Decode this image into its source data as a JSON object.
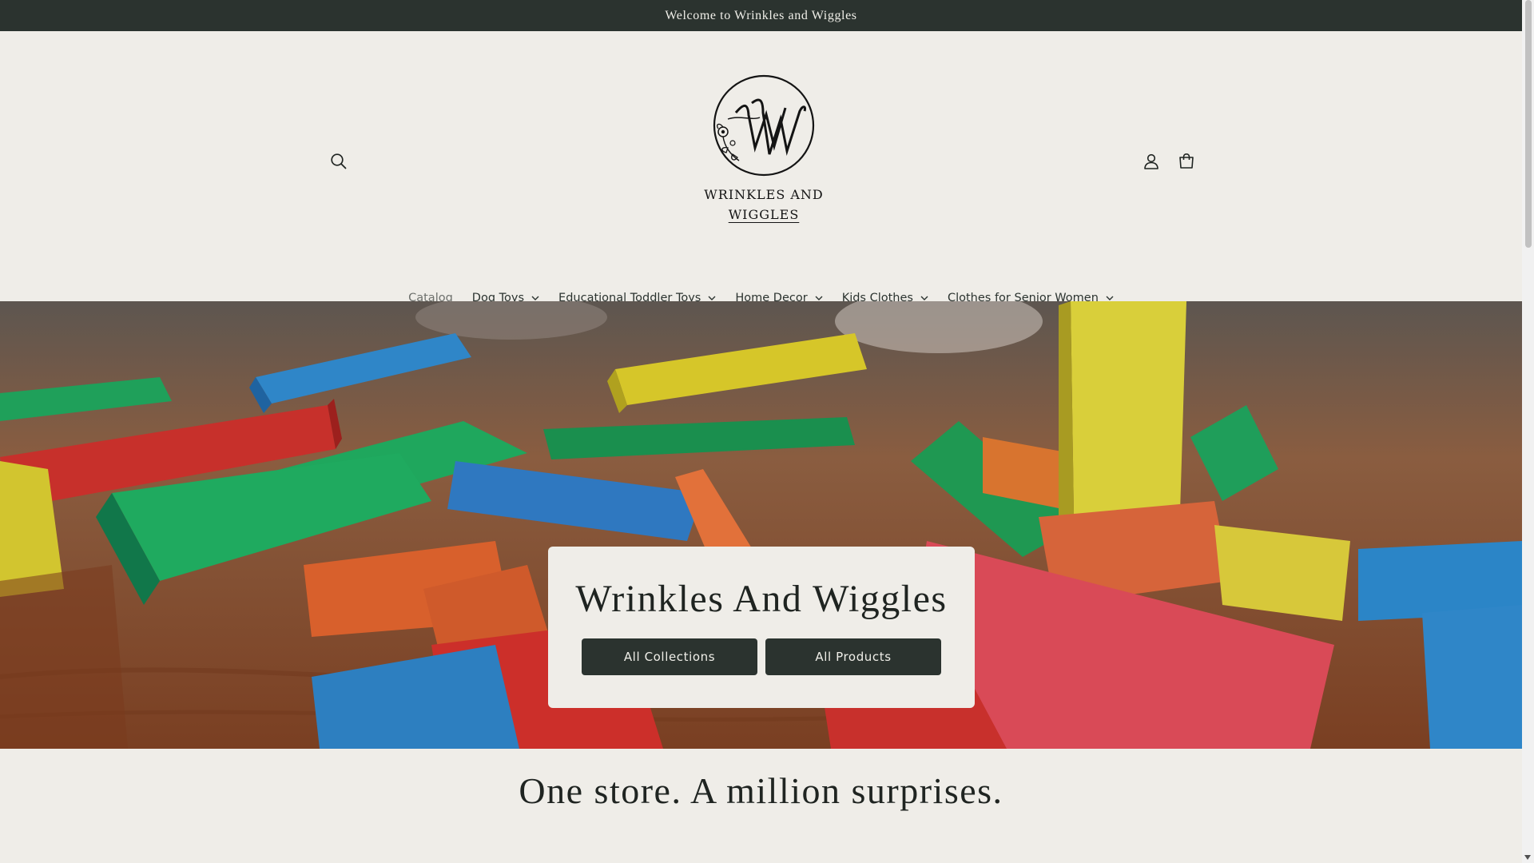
{
  "announcement": {
    "text": "Welcome to Wrinkles and Wiggles"
  },
  "header": {
    "logo": {
      "monogram": "WW",
      "line1": "WRINKLES AND",
      "line2": "WIGGLES"
    },
    "icons": {
      "search": "search-icon",
      "account": "account-icon",
      "cart": "cart-icon"
    }
  },
  "nav": {
    "items": [
      {
        "label": "Catalog",
        "dropdown": false
      },
      {
        "label": "Dog Toys",
        "dropdown": true
      },
      {
        "label": "Educational Toddler Toys",
        "dropdown": true
      },
      {
        "label": "Home Decor",
        "dropdown": true
      },
      {
        "label": "Kids Clothes",
        "dropdown": true
      },
      {
        "label": "Clothes for Senior Women",
        "dropdown": true
      }
    ]
  },
  "hero": {
    "title": "Wrinkles And Wiggles",
    "buttons": [
      "All Collections",
      "All Products"
    ]
  },
  "tagline": "One store. A million surprises.",
  "colors": {
    "announcement_bg": "#2b332f",
    "page_bg": "#efede8",
    "button_bg": "#2b332f",
    "text": "#1f2421"
  }
}
